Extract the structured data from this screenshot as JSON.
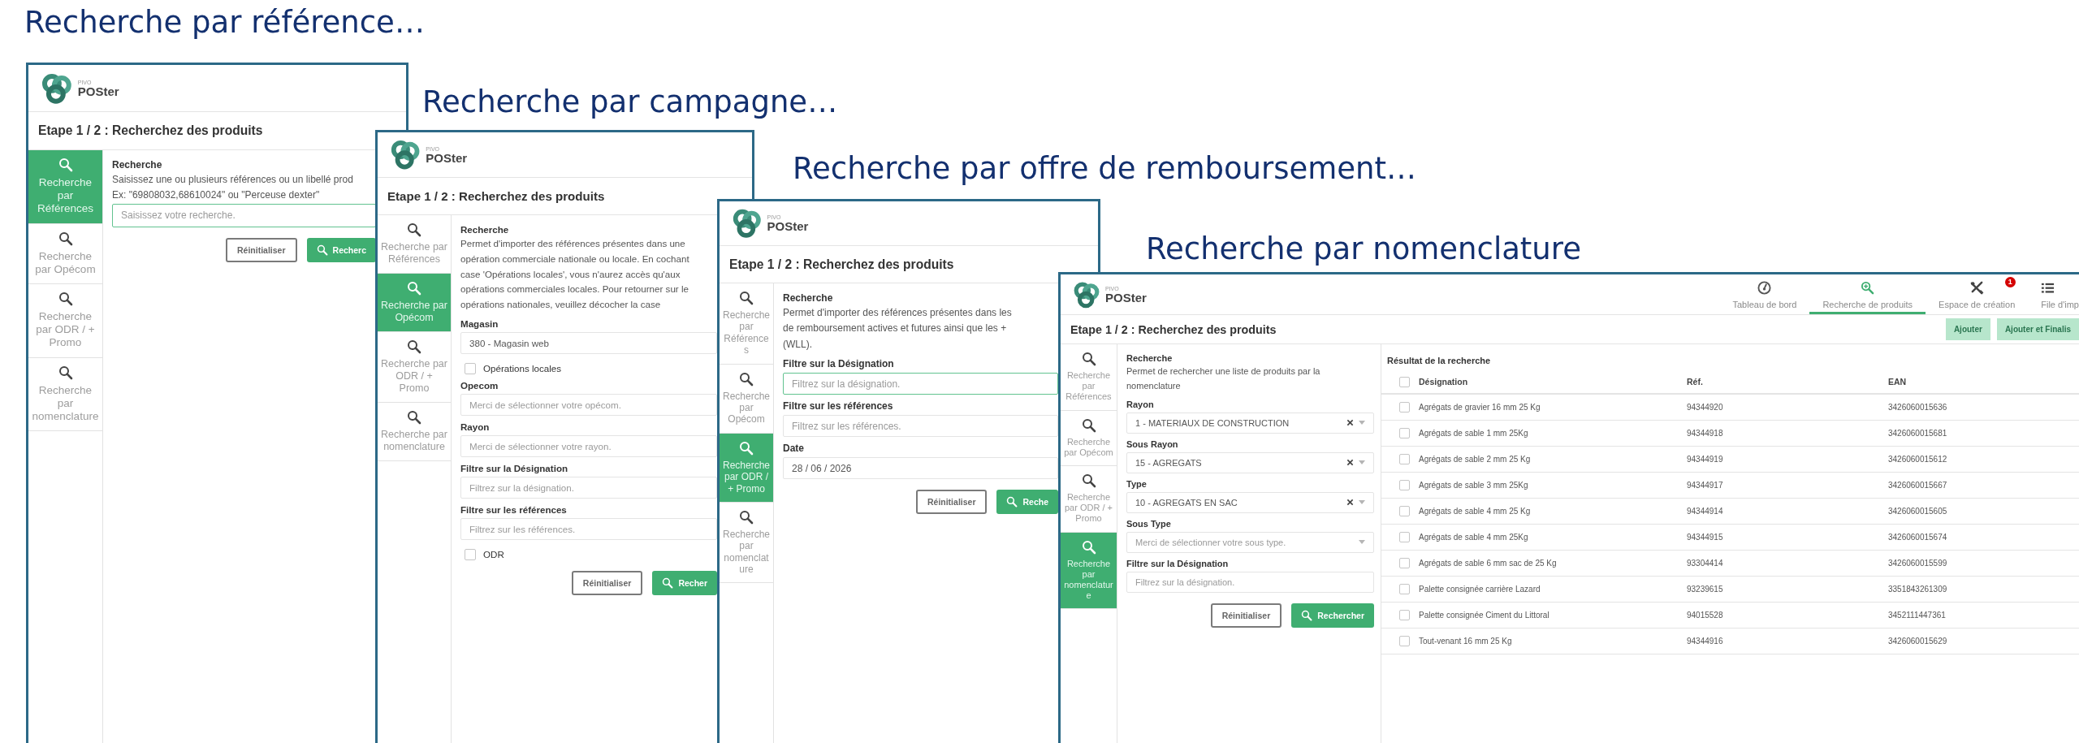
{
  "slides": [
    {
      "caption": "Recherche par référence…",
      "window": {
        "logo": {
          "brand": "PIVO",
          "product": "POSter"
        },
        "step_title": "Etape 1 / 2 : Recherchez des produits",
        "sidebar": [
          {
            "label": "Recherche par Références",
            "selected": true
          },
          {
            "label": "Recherche par Opécom",
            "selected": false
          },
          {
            "label": "Recherche par ODR / + Promo",
            "selected": false
          },
          {
            "label": "Recherche par nomenclature",
            "selected": false
          }
        ],
        "form": {
          "heading": "Recherche",
          "description": [
            "Saisissez une ou plusieurs références ou un libellé prod",
            "Ex: \"69808032,68610024\" ou \"Perceuse dexter\""
          ],
          "fields": [
            {
              "kind": "input",
              "placeholder": "Saisissez votre recherche.",
              "focused": true
            }
          ],
          "buttons": [
            {
              "kind": "reset",
              "label": "Réinitialiser"
            },
            {
              "kind": "search",
              "label": "Recherc"
            }
          ]
        }
      }
    },
    {
      "caption": "Recherche par campagne…",
      "window": {
        "logo": {
          "brand": "PIVO",
          "product": "POSter"
        },
        "step_title": "Etape 1 / 2 : Recherchez des produits",
        "sidebar": [
          {
            "label": "Recherche par Références",
            "selected": false
          },
          {
            "label": "Recherche par Opécom",
            "selected": true
          },
          {
            "label": "Recherche par ODR / + Promo",
            "selected": false
          },
          {
            "label": "Recherche par nomenclature",
            "selected": false
          }
        ],
        "form": {
          "heading": "Recherche",
          "description": [
            "Permet d'importer des références présentes dans une",
            "opération commerciale nationale ou locale. En cochant",
            "case 'Opérations locales', vous n'aurez accès qu'aux",
            "opérations commerciales locales. Pour retourner sur le",
            "opérations nationales, veuillez décocher la case"
          ],
          "fields": [
            {
              "kind": "input",
              "label": "Magasin",
              "value": "380 - Magasin web",
              "focused": false
            },
            {
              "kind": "checkbox",
              "label": "Opérations locales",
              "checked": false
            },
            {
              "kind": "input",
              "label": "Opecom",
              "placeholder": "Merci de sélectionner votre opécom.",
              "focused": false
            },
            {
              "kind": "input",
              "label": "Rayon",
              "placeholder": "Merci de sélectionner votre rayon.",
              "focused": false
            },
            {
              "kind": "input",
              "label": "Filtre sur la Désignation",
              "placeholder": "Filtrez sur la désignation.",
              "focused": false
            },
            {
              "kind": "input",
              "label": "Filtre sur les références",
              "placeholder": "Filtrez sur les références.",
              "focused": false
            },
            {
              "kind": "checkbox",
              "label": "ODR",
              "checked": false
            }
          ],
          "buttons": [
            {
              "kind": "reset",
              "label": "Réinitialiser"
            },
            {
              "kind": "search",
              "label": "Recher"
            }
          ]
        }
      }
    },
    {
      "caption": "Recherche par offre de remboursement…",
      "window": {
        "logo": {
          "brand": "PIVO",
          "product": "POSter"
        },
        "step_title": "Etape 1 / 2 : Recherchez des produits",
        "sidebar": [
          {
            "label": "Recherche par Références",
            "selected": false
          },
          {
            "label": "Recherche par Opécom",
            "selected": false
          },
          {
            "label": "Recherche par ODR / + Promo",
            "selected": true
          },
          {
            "label": "Recherche par nomenclature",
            "selected": false
          }
        ],
        "form": {
          "heading": "Recherche",
          "description": [
            "Permet d'importer des références présentes dans les",
            "de remboursement actives et futures ainsi que les +",
            "(WLL)."
          ],
          "fields": [
            {
              "kind": "input",
              "label": "Filtre sur la Désignation",
              "placeholder": "Filtrez sur la désignation.",
              "focused": true
            },
            {
              "kind": "input",
              "label": "Filtre sur les références",
              "placeholder": "Filtrez sur les références.",
              "focused": false
            },
            {
              "kind": "input",
              "label": "Date",
              "value": "28 / 06 / 2026",
              "focused": false
            }
          ],
          "buttons": [
            {
              "kind": "reset",
              "label": "Réinitialiser"
            },
            {
              "kind": "search",
              "label": "Reche"
            }
          ]
        }
      }
    },
    {
      "caption": "Recherche par nomenclature",
      "window": {
        "logo": {
          "brand": "PIVO",
          "product": "POSter"
        },
        "nav": [
          {
            "label": "Tableau de bord",
            "selected": false
          },
          {
            "label": "Recherche de produits",
            "selected": true
          },
          {
            "label": "Espace de création",
            "selected": false,
            "badge": "1"
          },
          {
            "label": "File d'imp",
            "selected": false
          }
        ],
        "step_title": "Etape 1 / 2 : Recherchez des produits",
        "actions": [
          {
            "label": "Ajouter",
            "disabled": true
          },
          {
            "label": "Ajouter et Finalis",
            "disabled": true
          }
        ],
        "sidebar": [
          {
            "label": "Recherche par Références",
            "selected": false
          },
          {
            "label": "Recherche par Opécom",
            "selected": false
          },
          {
            "label": "Recherche par ODR / + Promo",
            "selected": false
          },
          {
            "label": "Recherche par nomenclature",
            "selected": true
          }
        ],
        "form": {
          "heading": "Recherche",
          "description": [
            "Permet de rechercher une liste de produits par la",
            "nomenclature"
          ],
          "fields": [
            {
              "kind": "select",
              "label": "Rayon",
              "value": "1 - MATERIAUX DE CONSTRUCTION",
              "clearable": true
            },
            {
              "kind": "select",
              "label": "Sous Rayon",
              "value": "15 - AGREGATS",
              "clearable": true
            },
            {
              "kind": "select",
              "label": "Type",
              "value": "10 - AGREGATS EN SAC",
              "clearable": true
            },
            {
              "kind": "select",
              "label": "Sous Type",
              "placeholder": "Merci de sélectionner votre sous type.",
              "clearable": false
            },
            {
              "kind": "input",
              "label": "Filtre sur la Désignation",
              "placeholder": "Filtrez sur la désignation.",
              "focused": false
            }
          ],
          "buttons": [
            {
              "kind": "reset",
              "label": "Réinitialiser"
            },
            {
              "kind": "search",
              "label": "Rechercher"
            }
          ]
        },
        "results": {
          "title": "Résultat de la recherche",
          "all_checked": false,
          "columns": [
            "Désignation",
            "Réf.",
            "EAN"
          ],
          "rows": [
            {
              "cells": [
                "Agrégats de gravier 16 mm 25 Kg",
                "94344920",
                "3426060015636"
              ],
              "checked": false
            },
            {
              "cells": [
                "Agrégats de sable 1 mm 25Kg",
                "94344918",
                "3426060015681"
              ],
              "checked": false
            },
            {
              "cells": [
                "Agrégats de sable 2 mm 25 Kg",
                "94344919",
                "3426060015612"
              ],
              "checked": false
            },
            {
              "cells": [
                "Agrégats de sable 3 mm 25Kg",
                "94344917",
                "3426060015667"
              ],
              "checked": false
            },
            {
              "cells": [
                "Agrégats de sable 4 mm 25 Kg",
                "94344914",
                "3426060015605"
              ],
              "checked": false
            },
            {
              "cells": [
                "Agrégats de sable 4 mm 25Kg",
                "94344915",
                "3426060015674"
              ],
              "checked": false
            },
            {
              "cells": [
                "Agrégats de sable 6 mm sac de 25 Kg",
                "93304414",
                "3426060015599"
              ],
              "checked": false
            },
            {
              "cells": [
                "Palette consignée carrière Lazard",
                "93239615",
                "3351843261309"
              ],
              "checked": false
            },
            {
              "cells": [
                "Palette consignée Ciment du Littoral",
                "94015528",
                "3452111447361"
              ],
              "checked": false
            },
            {
              "cells": [
                "Tout-venant 16 mm 25 Kg",
                "94344916",
                "3426060015629"
              ],
              "checked": false
            }
          ]
        }
      }
    }
  ]
}
